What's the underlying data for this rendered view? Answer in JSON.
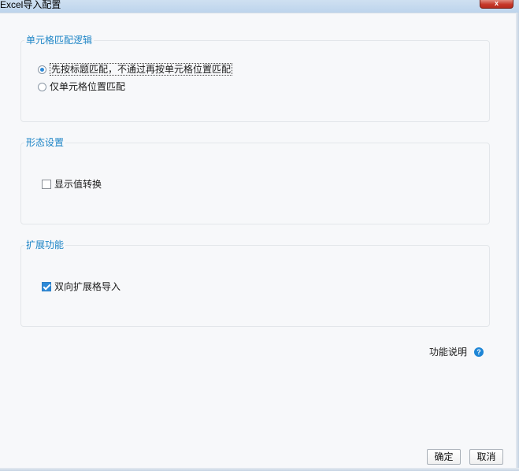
{
  "window": {
    "title": "Excel导入配置",
    "close_glyph": "x"
  },
  "group_matching": {
    "legend": "单元格匹配逻辑",
    "options": [
      {
        "label": "先按标题匹配，不通过再按单元格位置匹配",
        "selected": true
      },
      {
        "label": "仅单元格位置匹配",
        "selected": false
      }
    ]
  },
  "group_form": {
    "legend": "形态设置",
    "checkbox_label": "显示值转换",
    "checked": false
  },
  "group_extend": {
    "legend": "扩展功能",
    "checkbox_label": "双向扩展格导入",
    "checked": true
  },
  "help": {
    "label": "功能说明",
    "icon": "help-icon",
    "icon_glyph": "?"
  },
  "buttons": {
    "ok_label": "确定",
    "cancel_label": "取消"
  },
  "colors": {
    "accent": "#1c84c6",
    "check_fill": "#2e8ad8",
    "close_button": "#c7392b"
  }
}
